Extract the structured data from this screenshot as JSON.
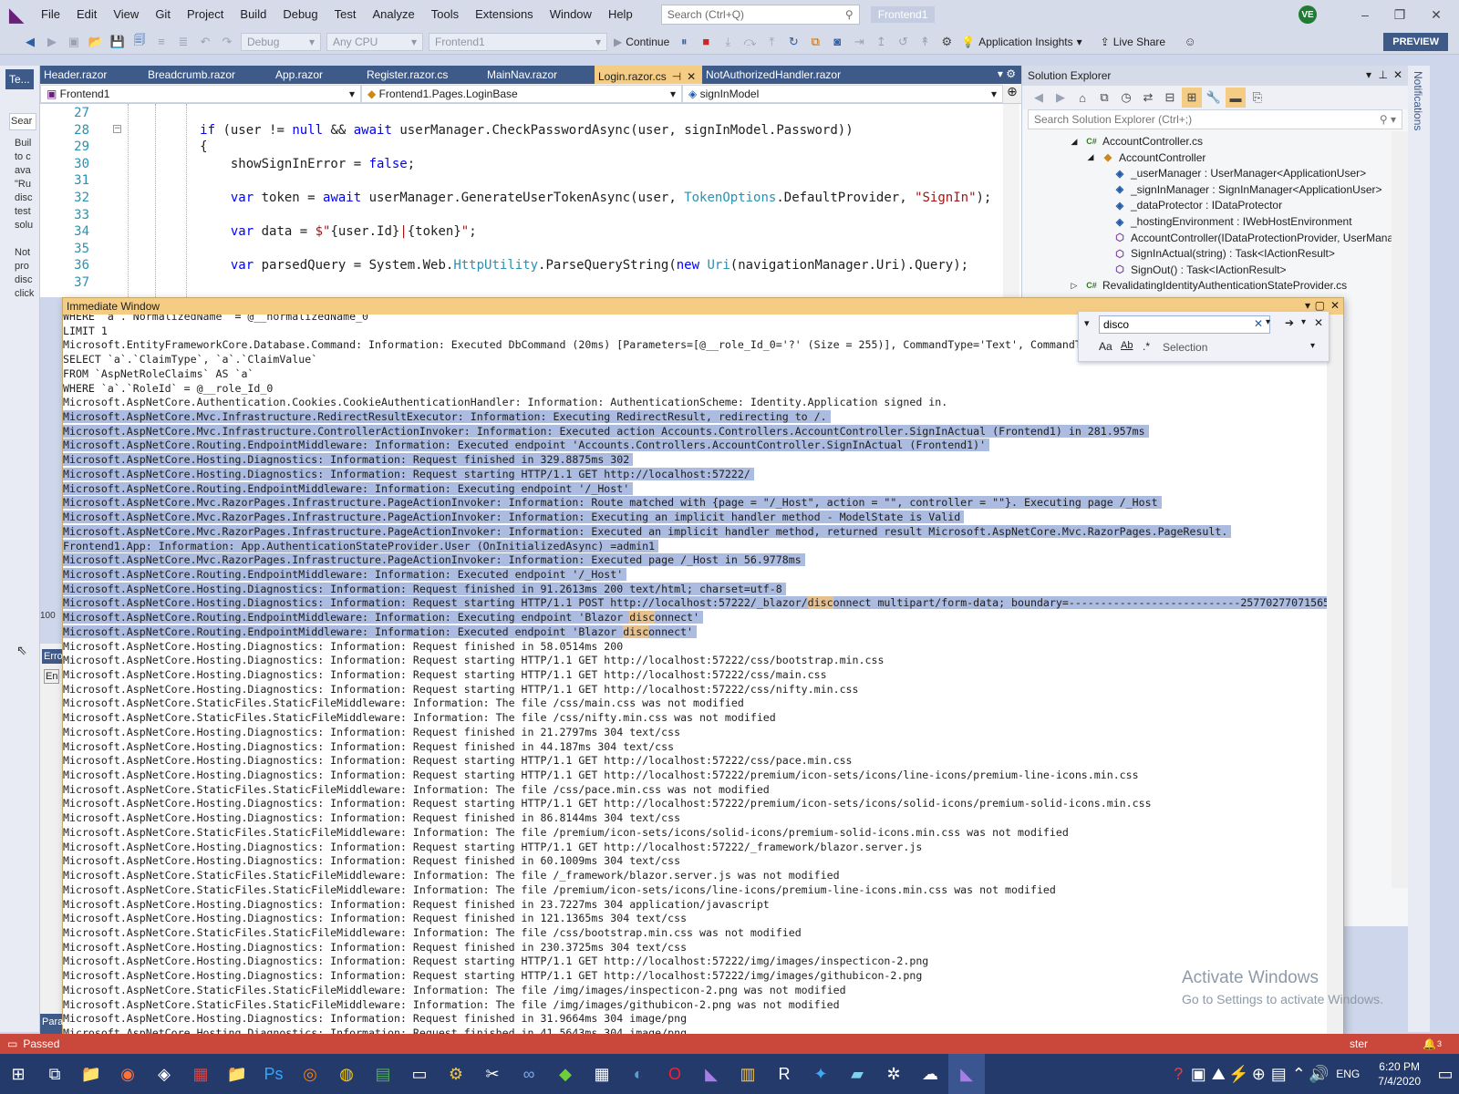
{
  "menubar": {
    "items": [
      "File",
      "Edit",
      "View",
      "Git",
      "Project",
      "Build",
      "Debug",
      "Test",
      "Analyze",
      "Tools",
      "Extensions",
      "Window",
      "Help"
    ],
    "search_placeholder": "Search (Ctrl+Q)",
    "solution_name": "Frontend1",
    "avatar_initials": "VE"
  },
  "toolbar": {
    "config": "Debug",
    "platform": "Any CPU",
    "startup_project": "Frontend1",
    "continue_label": "Continue",
    "insights_label": "Application Insights",
    "live_share_label": "Live Share",
    "preview_label": "PREVIEW"
  },
  "left_rail": {
    "tab_label": "Te...",
    "search_frag": "Sear",
    "text_lines": [
      "Buil",
      "to c",
      "ava",
      "\"Ru",
      "disc",
      "test",
      "solu",
      "",
      "Not",
      "pro",
      "disc",
      "click"
    ],
    "zoom": "100",
    "bottom_tab": "Erro",
    "bottom_sub": "En"
  },
  "editor": {
    "tabs": [
      "Header.razor",
      "Breadcrumb.razor",
      "App.razor",
      "Register.razor.cs",
      "MainNav.razor",
      "Login.razor.cs",
      "NotAuthorizedHandler.razor"
    ],
    "active_tab": 5,
    "nav_project": "Frontend1",
    "nav_class": "Frontend1.Pages.LoginBase",
    "nav_member": "signInModel",
    "lines": [
      {
        "n": "27",
        "c": []
      },
      {
        "n": "28",
        "c": [
          [
            "",
            "            "
          ],
          [
            "kw",
            "if"
          ],
          [
            "",
            " (user != "
          ],
          [
            "kw",
            "null"
          ],
          [
            "",
            " && "
          ],
          [
            "kw",
            "await"
          ],
          [
            "",
            " userManager.CheckPasswordAsync(user, signInModel.Password))"
          ]
        ]
      },
      {
        "n": "29",
        "c": [
          [
            "",
            "            {"
          ]
        ]
      },
      {
        "n": "30",
        "c": [
          [
            "",
            "                showSignInError = "
          ],
          [
            "kw",
            "false"
          ],
          [
            "",
            ";"
          ]
        ]
      },
      {
        "n": "31",
        "c": []
      },
      {
        "n": "32",
        "c": [
          [
            "",
            "                "
          ],
          [
            "kw",
            "var"
          ],
          [
            "",
            " token = "
          ],
          [
            "kw",
            "await"
          ],
          [
            "",
            " userManager.GenerateUserTokenAsync(user, "
          ],
          [
            "ty",
            "TokenOptions"
          ],
          [
            "",
            ".DefaultProvider, "
          ],
          [
            "st",
            "\"SignIn\""
          ],
          [
            "",
            ");"
          ]
        ]
      },
      {
        "n": "33",
        "c": []
      },
      {
        "n": "34",
        "c": [
          [
            "",
            "                "
          ],
          [
            "kw",
            "var"
          ],
          [
            "",
            " data = "
          ],
          [
            "st",
            "$\""
          ],
          [
            "",
            "{user.Id}"
          ],
          [
            "st",
            "|"
          ],
          [
            "",
            "{token}"
          ],
          [
            "st",
            "\""
          ],
          [
            "",
            ";"
          ]
        ]
      },
      {
        "n": "35",
        "c": []
      },
      {
        "n": "36",
        "c": [
          [
            "",
            "                "
          ],
          [
            "kw",
            "var"
          ],
          [
            "",
            " parsedQuery = System.Web."
          ],
          [
            "ty",
            "HttpUtility"
          ],
          [
            "",
            ".ParseQueryString("
          ],
          [
            "kw",
            "new"
          ],
          [
            "",
            " "
          ],
          [
            "ty",
            "Uri"
          ],
          [
            "",
            "(navigationManager.Uri).Query);"
          ]
        ]
      },
      {
        "n": "37",
        "c": []
      }
    ]
  },
  "solution_explorer": {
    "title": "Solution Explorer",
    "search_placeholder": "Search Solution Explorer (Ctrl+;)",
    "items": [
      {
        "icon": "cs-file-icon",
        "depth": 0,
        "text": "AccountController.cs",
        "glyph": "C#"
      },
      {
        "icon": "class-icon",
        "depth": 1,
        "text": "AccountController",
        "glyph": "◆"
      },
      {
        "icon": "field-icon",
        "depth": 2,
        "text": "_userManager : UserManager<ApplicationUser>",
        "glyph": "◈"
      },
      {
        "icon": "field-icon",
        "depth": 2,
        "text": "_signInManager : SignInManager<ApplicationUser>",
        "glyph": "◈"
      },
      {
        "icon": "field-icon",
        "depth": 2,
        "text": "_dataProtector : IDataProtector",
        "glyph": "◈"
      },
      {
        "icon": "field-icon",
        "depth": 2,
        "text": "_hostingEnvironment : IWebHostEnvironment",
        "glyph": "◈"
      },
      {
        "icon": "method-icon",
        "depth": 2,
        "text": "AccountController(IDataProtectionProvider, UserMana",
        "glyph": "⬡"
      },
      {
        "icon": "method-icon",
        "depth": 2,
        "text": "SignInActual(string) : Task<IActionResult>",
        "glyph": "⬡"
      },
      {
        "icon": "method-icon",
        "depth": 2,
        "text": "SignOut() : Task<IActionResult>",
        "glyph": "⬡"
      },
      {
        "icon": "cs-file-icon",
        "depth": 0,
        "text": "RevalidatingIdentityAuthenticationStateProvider.cs",
        "glyph": "C#"
      }
    ]
  },
  "notifications_label": "Notifications",
  "immediate": {
    "title": "Immediate Window",
    "find_text": "disco",
    "find_scope": "Selection",
    "highlight": "disc",
    "lines": [
      {
        "t": "WHERE `a`.`NormalizedName` = @__normalizedName_0",
        "s": false
      },
      {
        "t": "LIMIT 1",
        "s": false
      },
      {
        "t": "Microsoft.EntityFrameworkCore.Database.Command: Information: Executed DbCommand (20ms) [Parameters=[@__role_Id_0='?' (Size = 255)], CommandType='Text', CommandTim",
        "s": false
      },
      {
        "t": "SELECT `a`.`ClaimType`, `a`.`ClaimValue`",
        "s": false
      },
      {
        "t": "FROM `AspNetRoleClaims` AS `a`",
        "s": false
      },
      {
        "t": "WHERE `a`.`RoleId` = @__role_Id_0",
        "s": false
      },
      {
        "t": "Microsoft.AspNetCore.Authentication.Cookies.CookieAuthenticationHandler: Information: AuthenticationScheme: Identity.Application signed in.",
        "s": false
      },
      {
        "t": "Microsoft.AspNetCore.Mvc.Infrastructure.RedirectResultExecutor: Information: Executing RedirectResult, redirecting to /.",
        "s": true
      },
      {
        "t": "Microsoft.AspNetCore.Mvc.Infrastructure.ControllerActionInvoker: Information: Executed action Accounts.Controllers.AccountController.SignInActual (Frontend1) in 281.957ms",
        "s": true
      },
      {
        "t": "Microsoft.AspNetCore.Routing.EndpointMiddleware: Information: Executed endpoint 'Accounts.Controllers.AccountController.SignInActual (Frontend1)'",
        "s": true
      },
      {
        "t": "Microsoft.AspNetCore.Hosting.Diagnostics: Information: Request finished in 329.8875ms 302",
        "s": true
      },
      {
        "t": "Microsoft.AspNetCore.Hosting.Diagnostics: Information: Request starting HTTP/1.1 GET http://localhost:57222/",
        "s": true
      },
      {
        "t": "Microsoft.AspNetCore.Routing.EndpointMiddleware: Information: Executing endpoint '/_Host'",
        "s": true
      },
      {
        "t": "Microsoft.AspNetCore.Mvc.RazorPages.Infrastructure.PageActionInvoker: Information: Route matched with {page = \"/_Host\", action = \"\", controller = \"\"}. Executing page /_Host",
        "s": true
      },
      {
        "t": "Microsoft.AspNetCore.Mvc.RazorPages.Infrastructure.PageActionInvoker: Information: Executing an implicit handler method - ModelState is Valid",
        "s": true
      },
      {
        "t": "Microsoft.AspNetCore.Mvc.RazorPages.Infrastructure.PageActionInvoker: Information: Executed an implicit handler method, returned result Microsoft.AspNetCore.Mvc.RazorPages.PageResult.",
        "s": true
      },
      {
        "t": "Frontend1.App: Information: App.AuthenticationStateProvider.User (OnInitializedAsync) =admin1",
        "s": true
      },
      {
        "t": "Microsoft.AspNetCore.Mvc.RazorPages.Infrastructure.PageActionInvoker: Information: Executed page /_Host in 56.9778ms",
        "s": true
      },
      {
        "t": "Microsoft.AspNetCore.Routing.EndpointMiddleware: Information: Executed endpoint '/_Host'",
        "s": true
      },
      {
        "t": "Microsoft.AspNetCore.Hosting.Diagnostics: Information: Request finished in 91.2613ms 200 text/html; charset=utf-8",
        "s": true
      },
      {
        "t": "Microsoft.AspNetCore.Hosting.Diagnostics: Information: Request starting HTTP/1.1 POST http://localhost:57222/_blazor/disconnect multipart/form-data; boundary=---------------------------25770277071565738",
        "s": true
      },
      {
        "t": "Microsoft.AspNetCore.Routing.EndpointMiddleware: Information: Executing endpoint 'Blazor disconnect'",
        "s": true
      },
      {
        "t": "Microsoft.AspNetCore.Routing.EndpointMiddleware: Information: Executed endpoint 'Blazor disconnect'",
        "s": true
      },
      {
        "t": "Microsoft.AspNetCore.Hosting.Diagnostics: Information: Request finished in 58.0514ms 200",
        "s": false
      },
      {
        "t": "Microsoft.AspNetCore.Hosting.Diagnostics: Information: Request starting HTTP/1.1 GET http://localhost:57222/css/bootstrap.min.css",
        "s": false
      },
      {
        "t": "Microsoft.AspNetCore.Hosting.Diagnostics: Information: Request starting HTTP/1.1 GET http://localhost:57222/css/main.css",
        "s": false
      },
      {
        "t": "Microsoft.AspNetCore.Hosting.Diagnostics: Information: Request starting HTTP/1.1 GET http://localhost:57222/css/nifty.min.css",
        "s": false
      },
      {
        "t": "Microsoft.AspNetCore.StaticFiles.StaticFileMiddleware: Information: The file /css/main.css was not modified",
        "s": false
      },
      {
        "t": "Microsoft.AspNetCore.StaticFiles.StaticFileMiddleware: Information: The file /css/nifty.min.css was not modified",
        "s": false
      },
      {
        "t": "Microsoft.AspNetCore.Hosting.Diagnostics: Information: Request finished in 21.2797ms 304 text/css",
        "s": false
      },
      {
        "t": "Microsoft.AspNetCore.Hosting.Diagnostics: Information: Request finished in 44.187ms 304 text/css",
        "s": false
      },
      {
        "t": "Microsoft.AspNetCore.Hosting.Diagnostics: Information: Request starting HTTP/1.1 GET http://localhost:57222/css/pace.min.css",
        "s": false
      },
      {
        "t": "Microsoft.AspNetCore.Hosting.Diagnostics: Information: Request starting HTTP/1.1 GET http://localhost:57222/premium/icon-sets/icons/line-icons/premium-line-icons.min.css",
        "s": false
      },
      {
        "t": "Microsoft.AspNetCore.StaticFiles.StaticFileMiddleware: Information: The file /css/pace.min.css was not modified",
        "s": false
      },
      {
        "t": "Microsoft.AspNetCore.Hosting.Diagnostics: Information: Request starting HTTP/1.1 GET http://localhost:57222/premium/icon-sets/icons/solid-icons/premium-solid-icons.min.css",
        "s": false
      },
      {
        "t": "Microsoft.AspNetCore.Hosting.Diagnostics: Information: Request finished in 86.8144ms 304 text/css",
        "s": false
      },
      {
        "t": "Microsoft.AspNetCore.StaticFiles.StaticFileMiddleware: Information: The file /premium/icon-sets/icons/solid-icons/premium-solid-icons.min.css was not modified",
        "s": false
      },
      {
        "t": "Microsoft.AspNetCore.Hosting.Diagnostics: Information: Request starting HTTP/1.1 GET http://localhost:57222/_framework/blazor.server.js",
        "s": false
      },
      {
        "t": "Microsoft.AspNetCore.Hosting.Diagnostics: Information: Request finished in 60.1009ms 304 text/css",
        "s": false
      },
      {
        "t": "Microsoft.AspNetCore.StaticFiles.StaticFileMiddleware: Information: The file /_framework/blazor.server.js was not modified",
        "s": false
      },
      {
        "t": "Microsoft.AspNetCore.StaticFiles.StaticFileMiddleware: Information: The file /premium/icon-sets/icons/line-icons/premium-line-icons.min.css was not modified",
        "s": false
      },
      {
        "t": "Microsoft.AspNetCore.Hosting.Diagnostics: Information: Request finished in 23.7227ms 304 application/javascript",
        "s": false
      },
      {
        "t": "Microsoft.AspNetCore.Hosting.Diagnostics: Information: Request finished in 121.1365ms 304 text/css",
        "s": false
      },
      {
        "t": "Microsoft.AspNetCore.StaticFiles.StaticFileMiddleware: Information: The file /css/bootstrap.min.css was not modified",
        "s": false
      },
      {
        "t": "Microsoft.AspNetCore.Hosting.Diagnostics: Information: Request finished in 230.3725ms 304 text/css",
        "s": false
      },
      {
        "t": "Microsoft.AspNetCore.Hosting.Diagnostics: Information: Request starting HTTP/1.1 GET http://localhost:57222/img/images/inspecticon-2.png",
        "s": false
      },
      {
        "t": "Microsoft.AspNetCore.Hosting.Diagnostics: Information: Request starting HTTP/1.1 GET http://localhost:57222/img/images/githubicon-2.png",
        "s": false
      },
      {
        "t": "Microsoft.AspNetCore.StaticFiles.StaticFileMiddleware: Information: The file /img/images/inspecticon-2.png was not modified",
        "s": false
      },
      {
        "t": "Microsoft.AspNetCore.StaticFiles.StaticFileMiddleware: Information: The file /img/images/githubicon-2.png was not modified",
        "s": false
      },
      {
        "t": "Microsoft.AspNetCore.Hosting.Diagnostics: Information: Request finished in 31.9664ms 304 image/png",
        "s": false
      },
      {
        "t": "Microsoft.AspNetCore.Hosting.Diagnostics: Information: Request finished in 41.5643ms 304 image/png",
        "s": false
      }
    ]
  },
  "statusbar": {
    "passed": "Passed",
    "bottom_left_tab": "Para",
    "right_text": "ster",
    "notif_count": "3"
  },
  "watermark": {
    "line1": "Activate Windows",
    "line2": "Go to Settings to activate Windows."
  },
  "taskbar": {
    "lang": "ENG",
    "time": "6:20 PM",
    "date": "7/4/2020"
  }
}
